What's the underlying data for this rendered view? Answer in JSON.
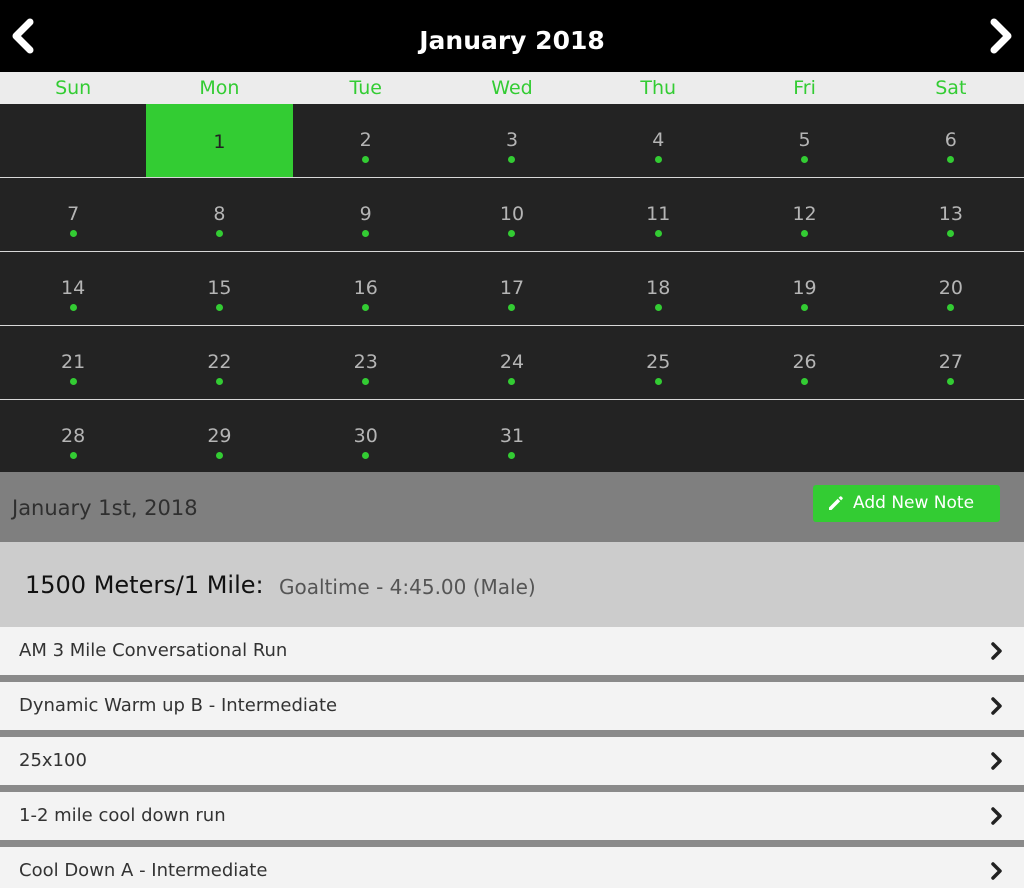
{
  "header": {
    "title": "January 2018",
    "prev_icon": "chevron-left-icon",
    "next_icon": "chevron-right-icon"
  },
  "weekdays": [
    "Sun",
    "Mon",
    "Tue",
    "Wed",
    "Thu",
    "Fri",
    "Sat"
  ],
  "calendar": {
    "selected_day": "1",
    "weeks": [
      [
        null,
        "1",
        "2",
        "3",
        "4",
        "5",
        "6"
      ],
      [
        "7",
        "8",
        "9",
        "10",
        "11",
        "12",
        "13"
      ],
      [
        "14",
        "15",
        "16",
        "17",
        "18",
        "19",
        "20"
      ],
      [
        "21",
        "22",
        "23",
        "24",
        "25",
        "26",
        "27"
      ],
      [
        "28",
        "29",
        "30",
        "31",
        null,
        null,
        null
      ]
    ]
  },
  "selected_date": {
    "label": "January 1st, 2018",
    "add_note_label": "Add New Note",
    "add_note_icon": "pencil-icon"
  },
  "event": {
    "title": "1500 Meters/1 Mile:",
    "subtitle": "Goaltime - 4:45.00 (Male)"
  },
  "workouts": [
    {
      "label": "AM 3 Mile Conversational Run"
    },
    {
      "label": "Dynamic Warm up B - Intermediate"
    },
    {
      "label": "25x100"
    },
    {
      "label": "1-2 mile cool down run"
    },
    {
      "label": "Cool Down A - Intermediate"
    }
  ],
  "colors": {
    "accent": "#33cc33",
    "header_bg": "#000000",
    "calendar_bg": "#232323",
    "date_bar_bg": "#7f7f7f"
  }
}
